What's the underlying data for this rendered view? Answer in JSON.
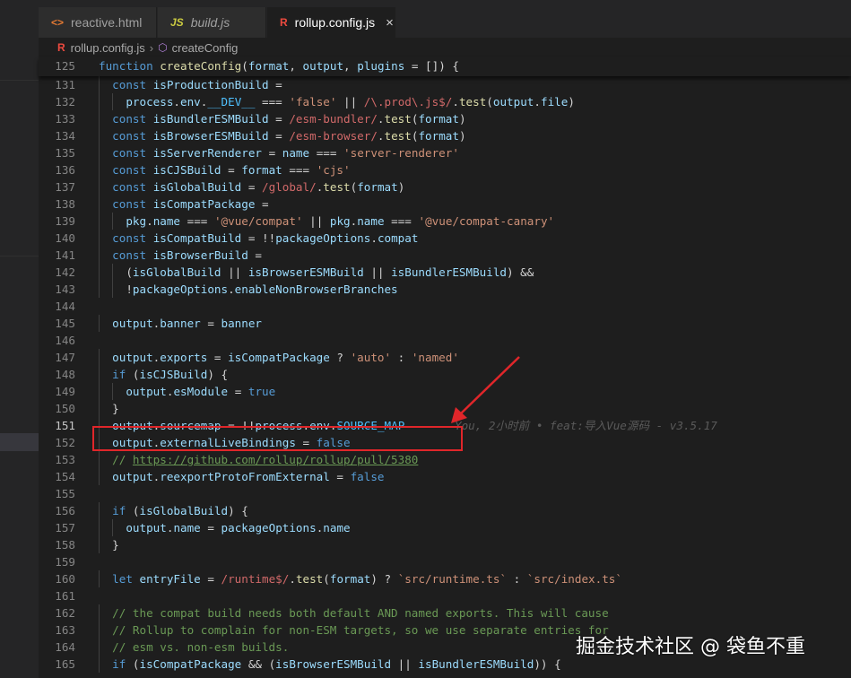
{
  "tabs": [
    {
      "icon": "<>",
      "label": "reactive.html"
    },
    {
      "icon": "JS",
      "label": "build.js"
    },
    {
      "icon": "R",
      "label": "rollup.config.js",
      "close": "×"
    }
  ],
  "breadcrumb": {
    "file": "rollup.config.js",
    "sep": "›",
    "symbol": "createConfig"
  },
  "colors": {
    "highlight": "#e0262a",
    "keyword": "#569cd6",
    "string": "#ce9178",
    "comment": "#6a9955"
  },
  "code_lines": [
    {
      "n": "125",
      "text": "function createConfig(format, output, plugins = []) {"
    },
    {
      "n": "131",
      "text": "  const isProductionBuild ="
    },
    {
      "n": "132",
      "text": "    process.env.__DEV__ === 'false' || /\\.prod\\.js$/.test(output.file)"
    },
    {
      "n": "133",
      "text": "  const isBundlerESMBuild = /esm-bundler/.test(format)"
    },
    {
      "n": "134",
      "text": "  const isBrowserESMBuild = /esm-browser/.test(format)"
    },
    {
      "n": "135",
      "text": "  const isServerRenderer = name === 'server-renderer'"
    },
    {
      "n": "136",
      "text": "  const isCJSBuild = format === 'cjs'"
    },
    {
      "n": "137",
      "text": "  const isGlobalBuild = /global/.test(format)"
    },
    {
      "n": "138",
      "text": "  const isCompatPackage ="
    },
    {
      "n": "139",
      "text": "    pkg.name === '@vue/compat' || pkg.name === '@vue/compat-canary'"
    },
    {
      "n": "140",
      "text": "  const isCompatBuild = !!packageOptions.compat"
    },
    {
      "n": "141",
      "text": "  const isBrowserBuild ="
    },
    {
      "n": "142",
      "text": "    (isGlobalBuild || isBrowserESMBuild || isBundlerESMBuild) &&"
    },
    {
      "n": "143",
      "text": "    !packageOptions.enableNonBrowserBranches"
    },
    {
      "n": "144",
      "text": ""
    },
    {
      "n": "145",
      "text": "  output.banner = banner"
    },
    {
      "n": "146",
      "text": ""
    },
    {
      "n": "147",
      "text": "  output.exports = isCompatPackage ? 'auto' : 'named'"
    },
    {
      "n": "148",
      "text": "  if (isCJSBuild) {"
    },
    {
      "n": "149",
      "text": "    output.esModule = true"
    },
    {
      "n": "150",
      "text": "  }"
    },
    {
      "n": "151",
      "text": "  output.sourcemap = !!process.env.SOURCE_MAP"
    },
    {
      "n": "152",
      "text": "  output.externalLiveBindings = false"
    },
    {
      "n": "153",
      "text": "  // https://github.com/rollup/rollup/pull/5380"
    },
    {
      "n": "154",
      "text": "  output.reexportProtoFromExternal = false"
    },
    {
      "n": "155",
      "text": ""
    },
    {
      "n": "156",
      "text": "  if (isGlobalBuild) {"
    },
    {
      "n": "157",
      "text": "    output.name = packageOptions.name"
    },
    {
      "n": "158",
      "text": "  }"
    },
    {
      "n": "159",
      "text": ""
    },
    {
      "n": "160",
      "text": "  let entryFile = /runtime$/.test(format) ? `src/runtime.ts` : `src/index.ts`"
    },
    {
      "n": "161",
      "text": ""
    },
    {
      "n": "162",
      "text": "  // the compat build needs both default AND named exports. This will cause"
    },
    {
      "n": "163",
      "text": "  // Rollup to complain for non-ESM targets, so we use separate entries for"
    },
    {
      "n": "164",
      "text": "  // esm vs. non-esm builds."
    },
    {
      "n": "165",
      "text": "  if (isCompatPackage && (isBrowserESMBuild || isBundlerESMBuild)) {"
    }
  ],
  "blame": "You, 2小时前 • feat:导入Vue源码 - v3.5.17",
  "watermark": "掘金技术社区 @ 袋鱼不重"
}
